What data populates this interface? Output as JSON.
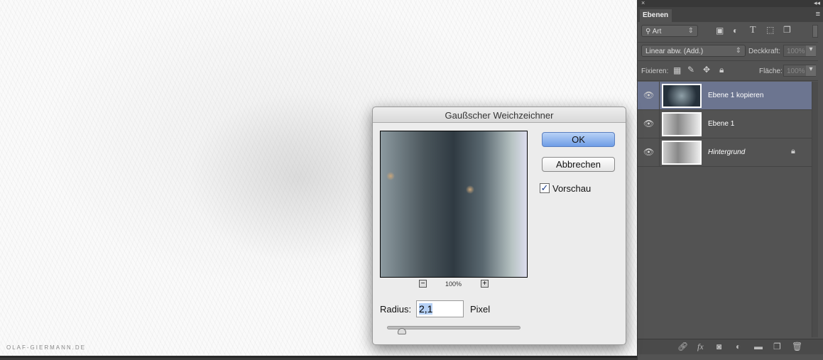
{
  "canvas": {
    "watermark": "OLAF-GIERMANN.DE"
  },
  "panel": {
    "tab": "Ebenen",
    "filter": "Art",
    "blend_mode": "Linear abw. (Add.)",
    "opacity_label": "Deckkraft:",
    "opacity_value": "100%",
    "lock_label": "Fixieren:",
    "fill_label": "Fläche:",
    "fill_value": "100%",
    "layers": [
      {
        "name": "Ebene 1 kopieren",
        "selected": true
      },
      {
        "name": "Ebene 1",
        "selected": false
      },
      {
        "name": "Hintergrund",
        "selected": false,
        "locked": true
      }
    ]
  },
  "dialog": {
    "title": "Gaußscher Weichzeichner",
    "ok": "OK",
    "cancel": "Abbrechen",
    "preview_label": "Vorschau",
    "preview_checked": true,
    "zoom": "100%",
    "radius_label": "Radius:",
    "radius_value": "2,1",
    "unit": "Pixel",
    "slider_fraction": 0.11
  },
  "colors": {
    "panel_bg": "#535353",
    "selected_layer": "#6c7590",
    "ok_button": "#7aa5ea"
  }
}
